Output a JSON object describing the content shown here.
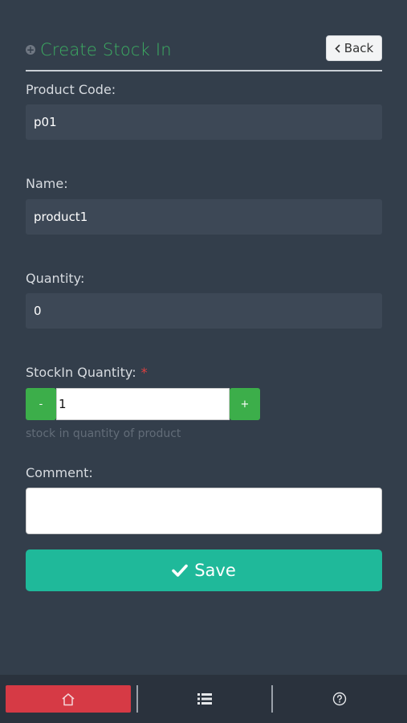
{
  "header": {
    "title": "Create Stock In",
    "back_label": "Back",
    "icons": {
      "title_icon": "plus-circle-icon",
      "back_icon": "chevron-left-icon"
    }
  },
  "form": {
    "product_code": {
      "label": "Product Code:",
      "value": "p01"
    },
    "name": {
      "label": "Name:",
      "value": "product1"
    },
    "quantity": {
      "label": "Quantity:",
      "value": "0"
    },
    "stockin_quantity": {
      "label": "StockIn Quantity:",
      "required_mark": "*",
      "minus_label": "-",
      "plus_label": "+",
      "value": "1",
      "help_text": "stock in quantity of product"
    },
    "comment": {
      "label": "Comment:",
      "value": ""
    }
  },
  "save": {
    "label": "Save",
    "icon": "check-icon"
  },
  "bottom_nav": {
    "items": [
      {
        "icon": "home-icon",
        "active": true
      },
      {
        "icon": "list-icon",
        "active": false
      },
      {
        "icon": "help-circle-icon",
        "active": false
      }
    ]
  },
  "colors": {
    "background": "#333e4b",
    "accent_green": "#3cae62",
    "save_teal": "#1fb99a",
    "active_nav_red": "#d63a45"
  }
}
